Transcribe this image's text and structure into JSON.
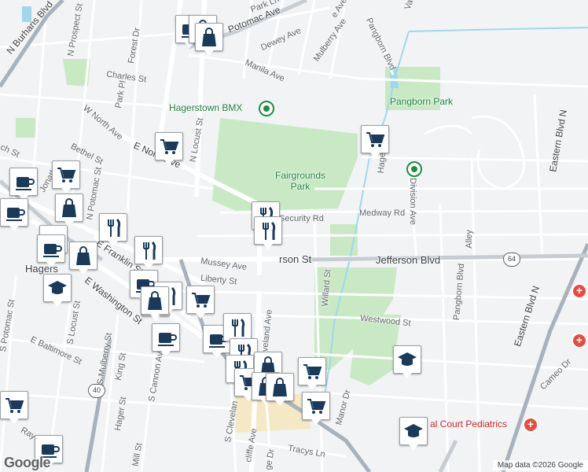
{
  "map": {
    "logo": "Google",
    "attribution": "Map data ©2026 Google",
    "colors": {
      "land": "#f1f3f4",
      "park": "#c9e9c4",
      "water": "#9fd8ec",
      "road": "#ffffff",
      "highway": "#a7b2bd",
      "campus": "#f5e8c4"
    }
  },
  "labels": {
    "potomac_ave": "Potomac Ave",
    "park_ln": "Park Ln",
    "dewey_ave": "Dewey Ave",
    "mulberry_ave": "Mulberry Ave",
    "manila_ave": "Manila Ave",
    "pangborn_blvd": "Pangborn Blvd",
    "n_burhans_blvd": "N Burhans Blvd",
    "n_prospect_st": "N Prospect St",
    "forest_dr": "Forest Dr",
    "charles_st": "Charles St",
    "park_pl": "Park Pl",
    "w_north_ave": "W North Ave",
    "bethel_st": "Bethel St",
    "church_st": "ch St",
    "e_north_ave": "E North Ave",
    "n_locust_st": "N Locust St",
    "n_potomac_st": "N Potomac St",
    "n_jonathan": "Jonathan",
    "security_rd": "Security Rd",
    "medway_rd": "Medway Rd",
    "division_ave": "Division Ave",
    "jefferson_st": "rson St",
    "jefferson_blvd": "Jefferson Blvd",
    "mussey_ave": "Mussey Ave",
    "liberty_st": "Liberty St",
    "n_cleveland_ave": "N Cleveland Ave",
    "willard_st": "Willard St",
    "westwood_st": "Westwood St",
    "pangborn_blvd_s": "Pangborn Blvd",
    "alley": "Alley",
    "eastern_blvd_n": "Eastern Blvd N",
    "eastern_blvd_n2": "Eastern Blvd N",
    "cameo_dr": "Cameo Dr",
    "e_franklin_st": "E Franklin St",
    "e_washington_st": "E Washington St",
    "hagerstown": "Hagers",
    "s_potomac_st": "S Potomac St",
    "s_locust_st": "S Locust St",
    "e_baltimore_st": "E Baltimore St",
    "s_mulberry_st": "S Mulberry St",
    "king_st": "King St",
    "s_cannon_ave": "S Cannon Ave",
    "hager_st": "Hager St",
    "mill_st": "Mill St",
    "s_cleveland": "S Clevelan",
    "radcliffe_ave": "cliffe Ave",
    "manor_dr": "Manor Dr",
    "tracys_ln": "Tracys Ln",
    "ridge_dr": "ge Dr",
    "e_partial": "E",
    "hagers_run": "Hagers Run",
    "val": "Va",
    "ave_top": "e Ave",
    "e_potomac_short": "E",
    "ray": "Ray"
  },
  "places": {
    "bmx": "Hagerstown BMX",
    "pangborn_park": "Pangborn Park",
    "fairgrounds_park": "Fairgrounds\nPark",
    "court_pediatrics": "al Court Pediatrics"
  },
  "shields": {
    "route_64": "64",
    "route_40": "40"
  },
  "markers": [
    {
      "kind": "cafe-icon"
    },
    {
      "kind": "shopping-bag-icon"
    },
    {
      "kind": "shopping-bag-icon"
    },
    {
      "kind": "shopping-cart-icon"
    },
    {
      "kind": "shopping-cart-icon"
    },
    {
      "kind": "cafe-icon"
    },
    {
      "kind": "shopping-cart-icon"
    },
    {
      "kind": "cafe-icon"
    },
    {
      "kind": "shopping-bag-icon"
    },
    {
      "kind": "cafe-icon"
    },
    {
      "kind": "restaurant-icon"
    },
    {
      "kind": "shopping-bag-icon"
    },
    {
      "kind": "cafe-icon"
    },
    {
      "kind": "restaurant-icon"
    },
    {
      "kind": "school-icon"
    },
    {
      "kind": "shopping-bag-icon"
    },
    {
      "kind": "restaurant-icon"
    },
    {
      "kind": "restaurant-icon"
    },
    {
      "kind": "cafe-icon"
    },
    {
      "kind": "restaurant-icon"
    },
    {
      "kind": "shopping-bag-icon"
    },
    {
      "kind": "shopping-cart-icon"
    },
    {
      "kind": "cafe-icon"
    },
    {
      "kind": "cafe-icon"
    },
    {
      "kind": "restaurant-icon"
    },
    {
      "kind": "restaurant-icon"
    },
    {
      "kind": "restaurant-icon"
    },
    {
      "kind": "shopping-cart-icon"
    },
    {
      "kind": "shopping-bag-icon"
    },
    {
      "kind": "shopping-bag-icon"
    },
    {
      "kind": "shopping-bag-icon"
    },
    {
      "kind": "shopping-cart-icon"
    },
    {
      "kind": "school-icon"
    },
    {
      "kind": "shopping-cart-icon"
    },
    {
      "kind": "shopping-cart-icon"
    },
    {
      "kind": "school-icon"
    },
    {
      "kind": "cafe-icon"
    }
  ]
}
